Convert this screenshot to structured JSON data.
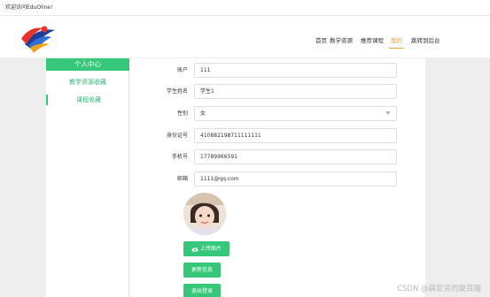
{
  "topbar": {
    "welcome": "欢迎访问EduOline!"
  },
  "brand": {
    "accent": "#36c77b",
    "nav_active": "#e6a23c"
  },
  "nav": {
    "items": [
      {
        "label": "首页",
        "active": false
      },
      {
        "label": "教学资源",
        "active": false
      },
      {
        "label": "推荐课程",
        "active": false
      },
      {
        "label": "我的",
        "active": true
      },
      {
        "label": "跳转到后台",
        "active": false
      }
    ]
  },
  "sidebar": {
    "title": "个人中心",
    "items": [
      {
        "label": "教学资源收藏"
      },
      {
        "label": "课程收藏"
      }
    ]
  },
  "form": {
    "account": {
      "label": "账户",
      "value": "111"
    },
    "name": {
      "label": "学生姓名",
      "value": "学生1"
    },
    "gender": {
      "label": "性别",
      "value": "女"
    },
    "id_card": {
      "label": "身份证号",
      "value": "410882198711111111"
    },
    "phone": {
      "label": "手机号",
      "value": "17789966591"
    },
    "email": {
      "label": "邮箱",
      "value": "1111@qq.com"
    }
  },
  "buttons": {
    "upload": "上传图片",
    "update": "更新信息",
    "logout": "退出登录"
  },
  "watermark": "CSDN @薛定谔的旋耳猫"
}
